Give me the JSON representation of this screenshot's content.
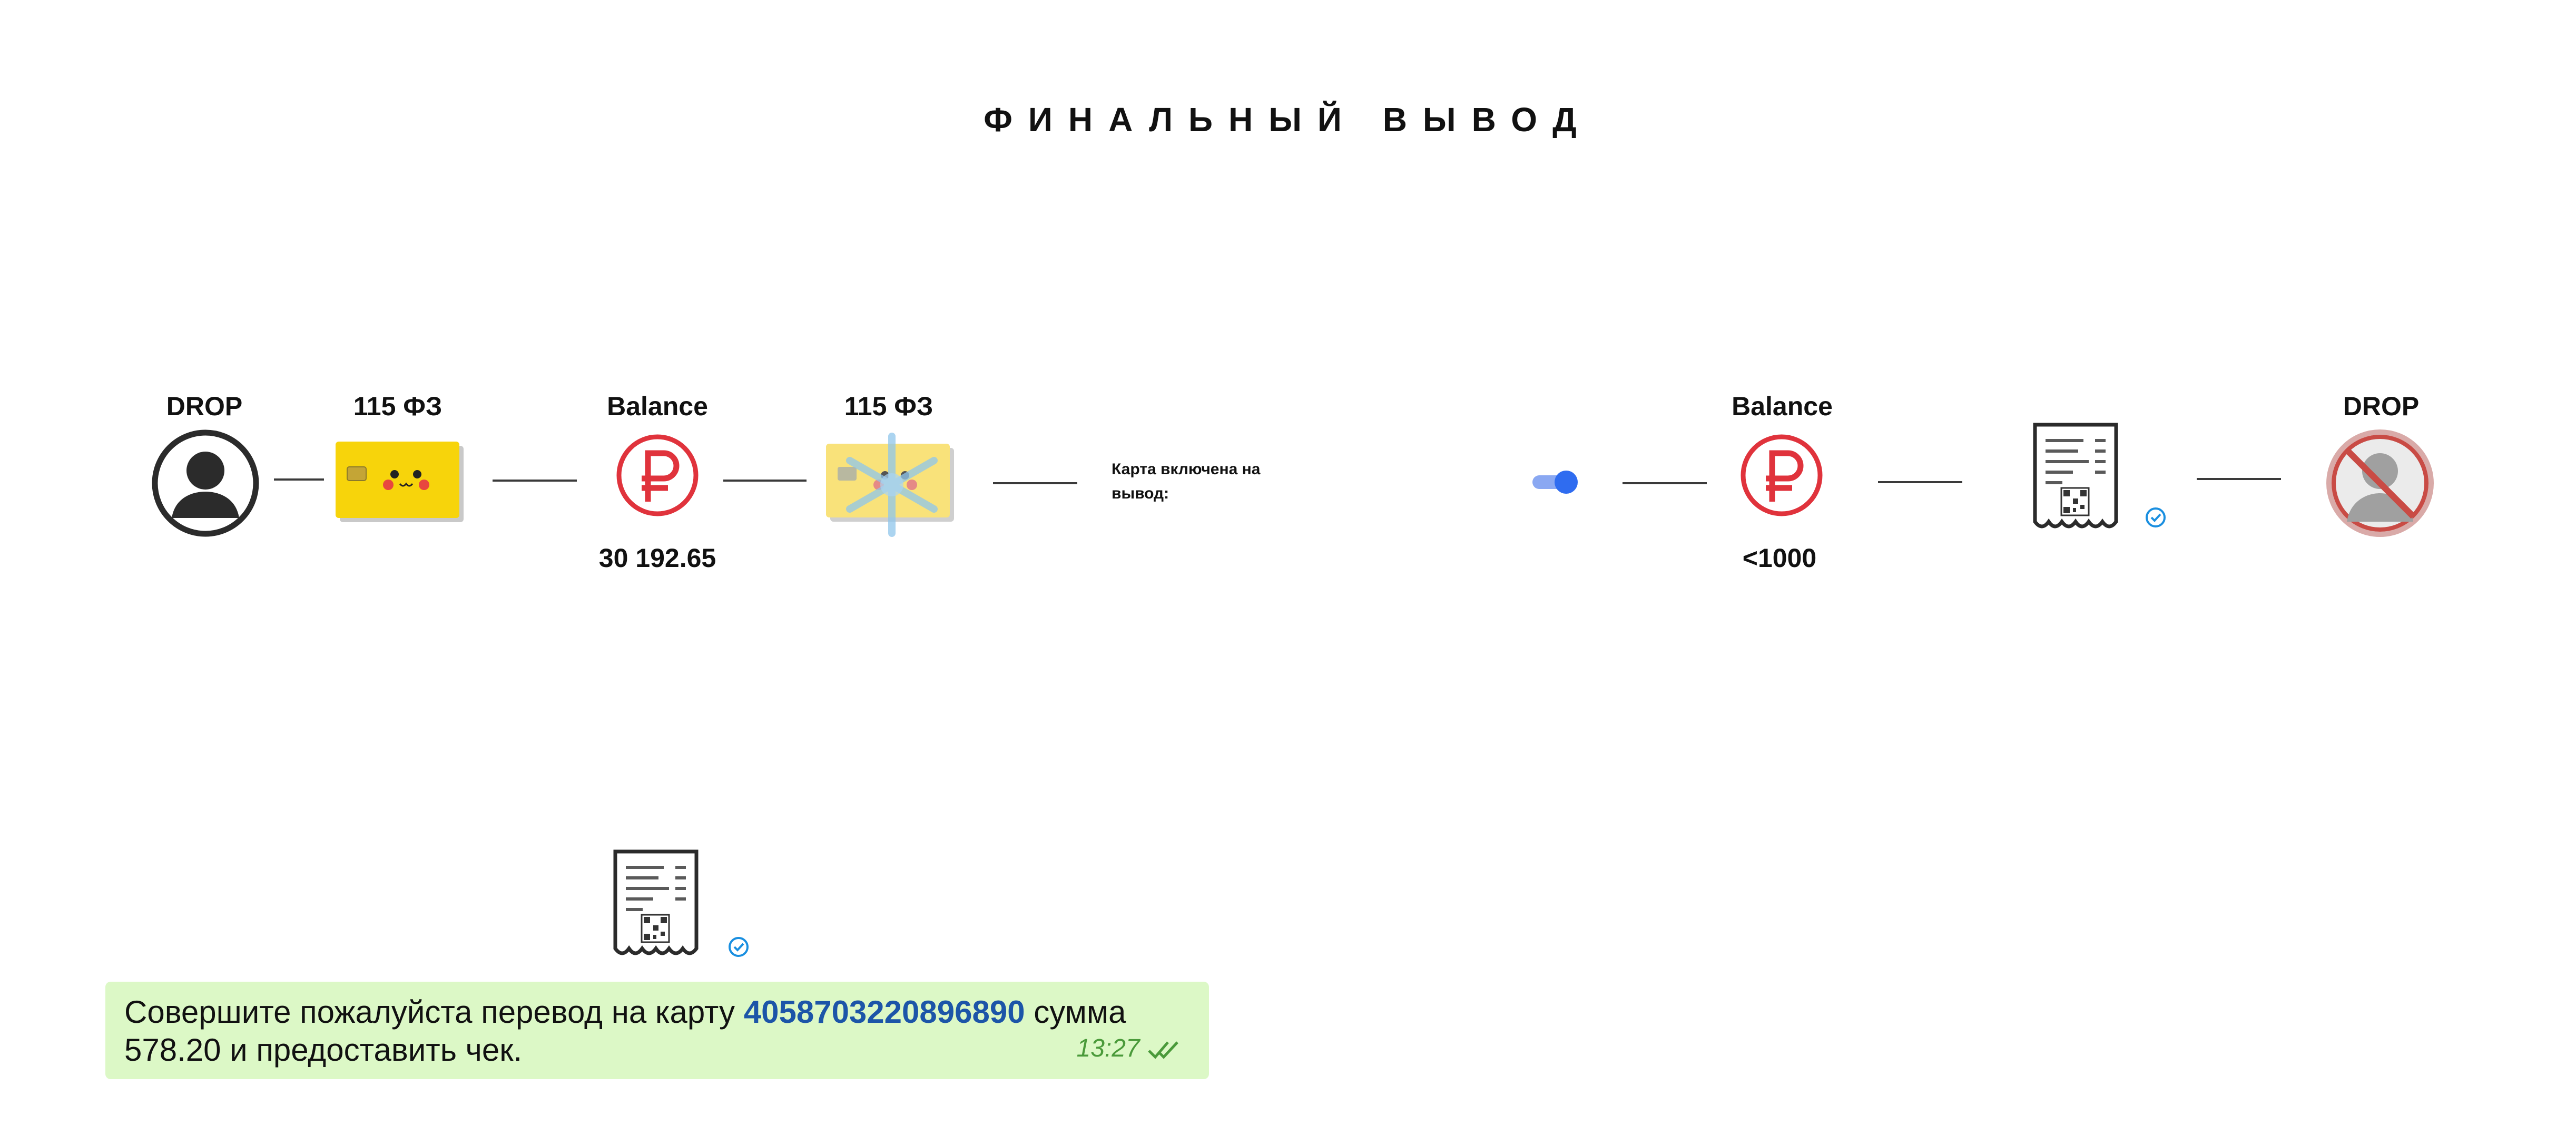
{
  "title": "ФИНАЛЬНЫЙ ВЫВОД",
  "nodes": {
    "drop_left": {
      "label": "DROP",
      "icon": "user-icon"
    },
    "card_1": {
      "label": "115 ФЗ",
      "icon": "bank-card-pikachu-icon"
    },
    "balance_1": {
      "label": "Balance",
      "value": "30 192.65",
      "icon": "ruble-icon"
    },
    "card_2": {
      "label": "115 ФЗ",
      "icon": "bank-card-frozen-icon"
    },
    "note": {
      "text": "Карта включена на вывод:"
    },
    "toggle": {
      "state": "on",
      "icon": "toggle-icon"
    },
    "balance_2": {
      "label": "Balance",
      "value": "<1000",
      "icon": "ruble-icon"
    },
    "receipt_right": {
      "icon": "receipt-icon",
      "badge": "check-badge-icon"
    },
    "drop_right": {
      "label": "DROP",
      "icon": "user-blocked-icon"
    }
  },
  "message": {
    "text_before": "Совершите пожалуйста перевод на карту ",
    "card_number": "4058703220896890",
    "text_after": " сумма 578.20 и предоставить чек.",
    "time": "13:27"
  },
  "colors": {
    "ruble": "#e0333c",
    "card_yellow": "#f7d40b",
    "toggle_blue": "#2f6cf0",
    "check_blue": "#1a8fe0",
    "message_bg": "#dcf8c6"
  }
}
